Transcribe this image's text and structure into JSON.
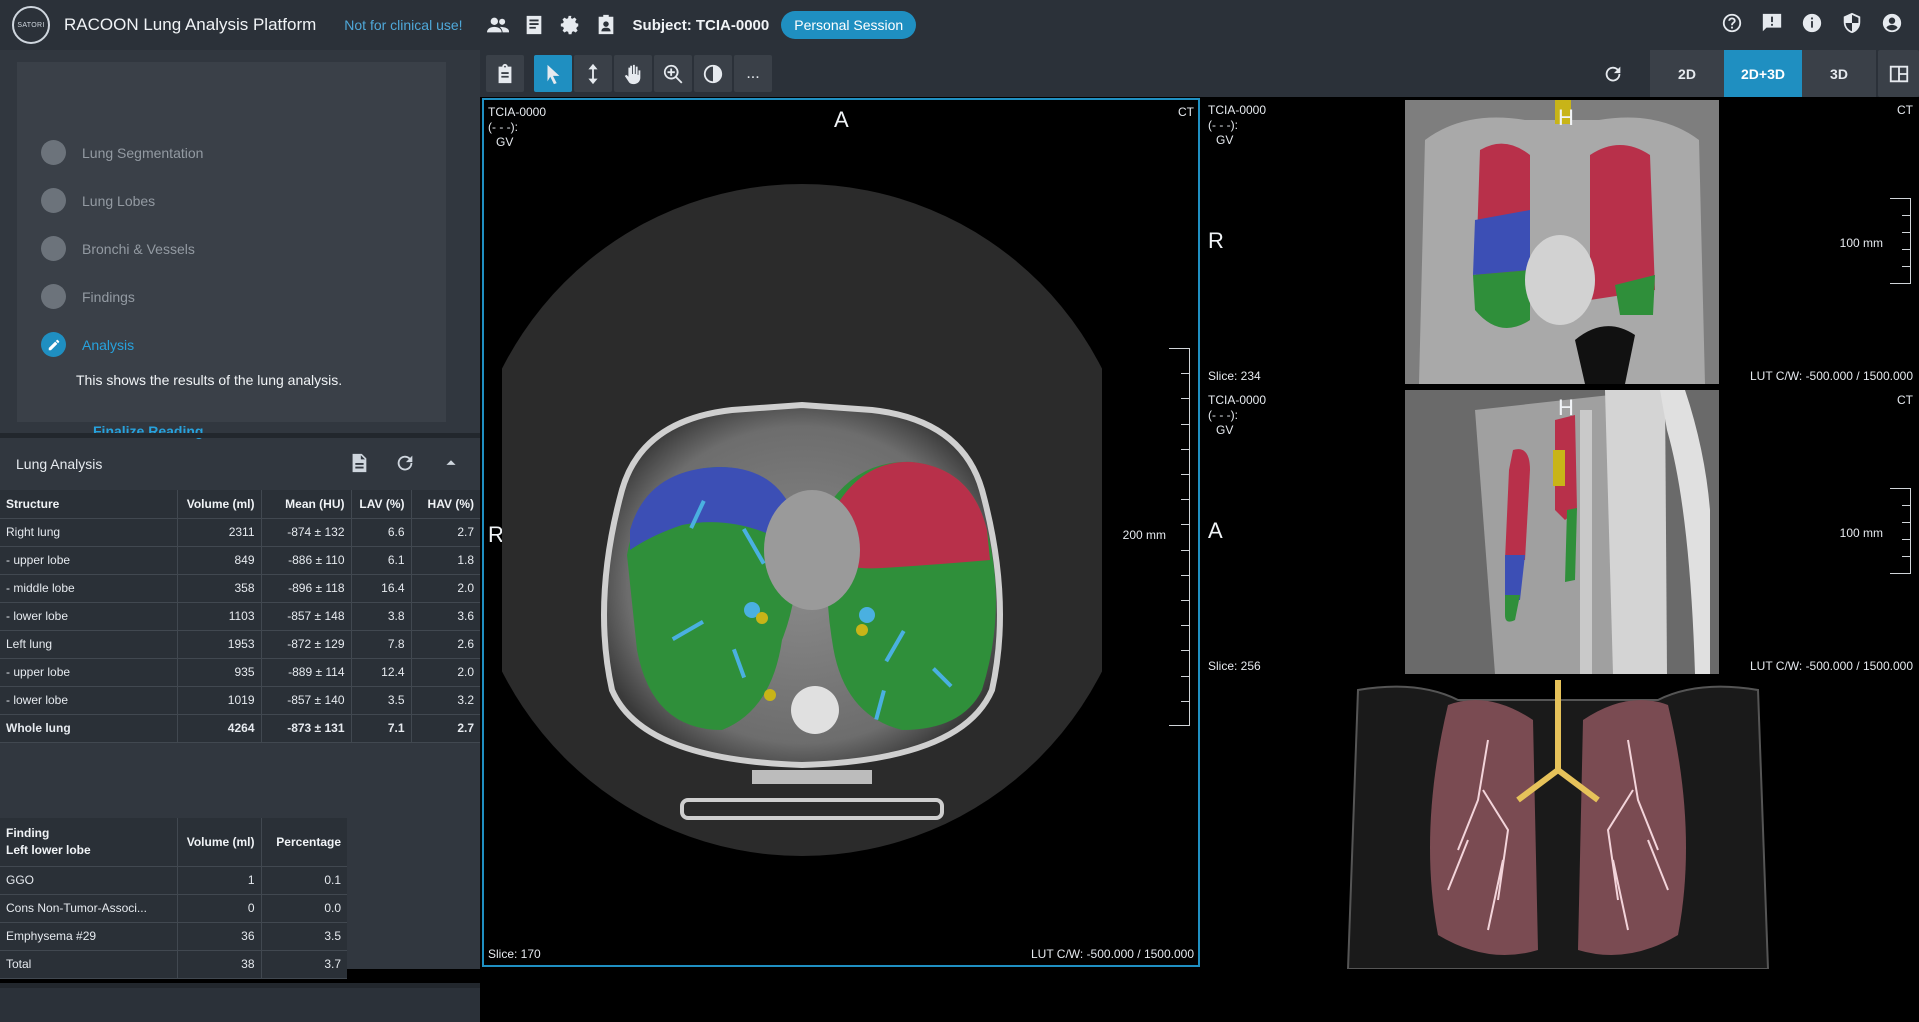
{
  "header": {
    "logo_text": "SATORI",
    "app_title": "RACOON Lung Analysis Platform",
    "warning": "Not for clinical use!",
    "left_icons": [
      "users-icon",
      "list-icon",
      "gear-icon",
      "badge-icon"
    ],
    "subject": "Subject: TCIA-0000",
    "session": "Personal Session",
    "right_icons": [
      "help-icon",
      "feedback-icon",
      "info-icon",
      "shield-icon",
      "account-icon"
    ]
  },
  "stepper": {
    "steps": [
      "Lung Segmentation",
      "Lung Lobes",
      "Bronchi & Vessels",
      "Findings",
      "Analysis"
    ],
    "active_step": "Analysis",
    "description": "This shows the results of the lung analysis.",
    "finalize": "Finalize Reading"
  },
  "lung_analysis": {
    "title": "Lung Analysis",
    "columns": [
      "Structure",
      "Volume (ml)",
      "Mean (HU)",
      "LAV (%)",
      "HAV (%)"
    ],
    "rows": [
      [
        "Right lung",
        "2311",
        "-874 ± 132",
        "6.6",
        "2.7"
      ],
      [
        "- upper lobe",
        "849",
        "-886 ± 110",
        "6.1",
        "1.8"
      ],
      [
        "- middle lobe",
        "358",
        "-896 ± 118",
        "16.4",
        "2.0"
      ],
      [
        "- lower lobe",
        "1103",
        "-857 ± 148",
        "3.8",
        "3.6"
      ],
      [
        "Left lung",
        "1953",
        "-872 ± 129",
        "7.8",
        "2.6"
      ],
      [
        "- upper lobe",
        "935",
        "-889 ± 114",
        "12.4",
        "2.0"
      ],
      [
        "- lower lobe",
        "1019",
        "-857 ± 140",
        "3.5",
        "3.2"
      ],
      [
        "Whole lung",
        "4264",
        "-873 ± 131",
        "7.1",
        "2.7"
      ]
    ]
  },
  "findings": {
    "col_finding": "Finding",
    "col_region": "Left lower lobe",
    "col_volume": "Volume (ml)",
    "col_percentage": "Percentage",
    "rows": [
      [
        "GGO",
        "1",
        "0.1"
      ],
      [
        "Cons Non-Tumor-Associ...",
        "0",
        "0.0"
      ],
      [
        "Emphysema #29",
        "36",
        "3.5"
      ],
      [
        "Total",
        "38",
        "3.7"
      ]
    ]
  },
  "toolbar": {
    "tools": [
      "clipboard-icon",
      "pointer-icon",
      "scroll-icon",
      "pan-icon",
      "zoom-icon",
      "contrast-icon"
    ],
    "more": "...",
    "refresh_icon": "refresh-icon",
    "views": [
      "2D",
      "2D+3D",
      "3D"
    ],
    "active_view": "2D+3D",
    "layout_icon": "layout-icon"
  },
  "viewports": {
    "axial": {
      "subject": "TCIA-0000",
      "line2": "(- - -):",
      "line3": "GV",
      "modality": "CT",
      "top": "A",
      "left": "R",
      "scale": "200 mm",
      "slice": "Slice: 170",
      "lut": "LUT C/W: -500.000 / 1500.000"
    },
    "coronal": {
      "subject": "TCIA-0000",
      "line2": "(- - -):",
      "line3": "GV",
      "modality": "CT",
      "top": "H",
      "left": "R",
      "scale": "100 mm",
      "slice": "Slice: 234",
      "lut": "LUT C/W: -500.000 / 1500.000"
    },
    "sagittal": {
      "subject": "TCIA-0000",
      "line2": "(- - -):",
      "line3": "GV",
      "modality": "CT",
      "top": "H",
      "left": "A",
      "scale": "100 mm",
      "slice": "Slice: 256",
      "lut": "LUT C/W: -500.000 / 1500.000"
    }
  },
  "colors": {
    "accent": "#1f8fc1",
    "upper_lobe": "#3a4fb0",
    "middle_lobe": "#2f9e44",
    "left_upper": "#b8304a",
    "vessel": "#4ab0e0"
  }
}
